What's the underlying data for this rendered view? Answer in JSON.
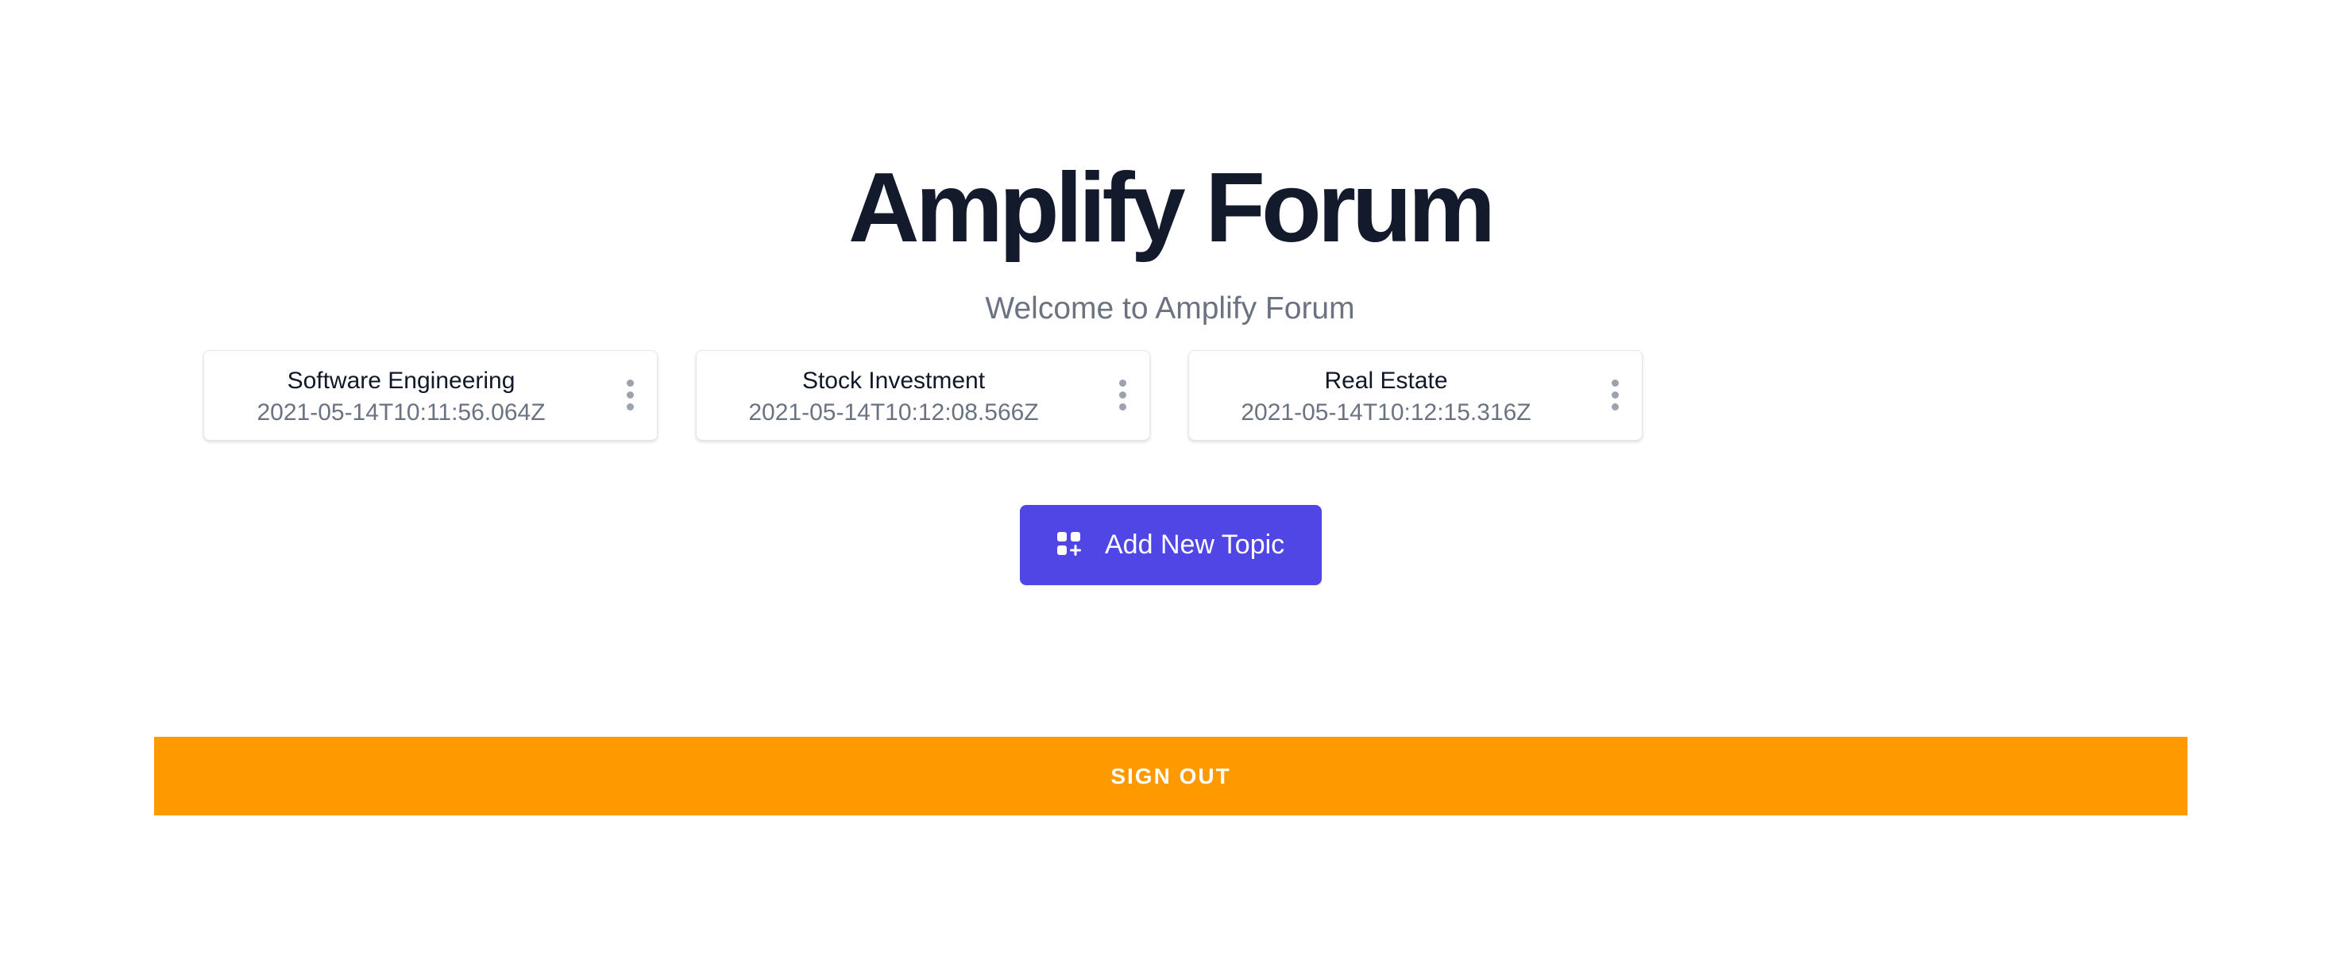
{
  "header": {
    "title": "Amplify Forum",
    "subtitle": "Welcome to Amplify Forum"
  },
  "topics": [
    {
      "name": "Software Engineering",
      "created_at": "2021-05-14T10:11:56.064Z"
    },
    {
      "name": "Stock Investment",
      "created_at": "2021-05-14T10:12:08.566Z"
    },
    {
      "name": "Real Estate",
      "created_at": "2021-05-14T10:12:15.316Z"
    }
  ],
  "actions": {
    "add_topic_label": "Add New Topic",
    "add_topic_icon": "view-grid-add-icon",
    "topic_menu_icon": "dots-vertical-icon",
    "sign_out_label": "SIGN OUT"
  },
  "colors": {
    "primary_button": "#4f46e5",
    "sign_out_button": "#ff9900",
    "title_text": "#131a2b",
    "muted_text": "#6b7280"
  }
}
